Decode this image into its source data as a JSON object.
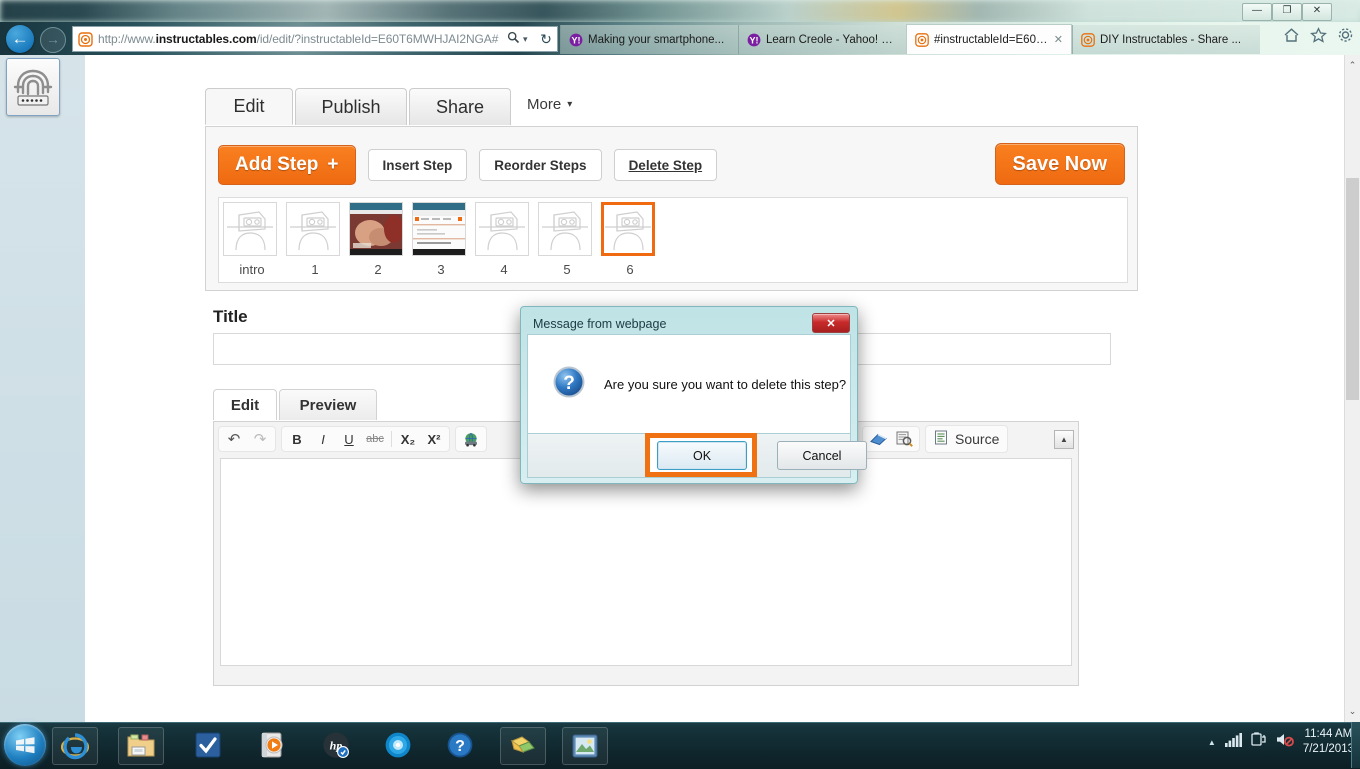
{
  "window": {
    "controls": {
      "minimize": "—",
      "maximize": "❐",
      "close": "✕"
    }
  },
  "browser": {
    "back_icon": "←",
    "forward_icon": "→",
    "address": {
      "prefix": "http://www.",
      "domain": "instructables.com",
      "path": "/id/edit/?instructableId=E60T6MWHJAI2NGA#",
      "full": "http://www.instructables.com/id/edit/?instructableId=E60T6MWHJAI2NGA#",
      "search_icon": "search-icon",
      "caret_icon": "▾",
      "refresh_icon": "↻"
    },
    "tabs": [
      {
        "title": "Making your smartphone...",
        "favicon": "yahoo-icon",
        "active": false,
        "closable": false
      },
      {
        "title": "Learn Creole - Yahoo! Sea...",
        "favicon": "yahoo-icon",
        "active": false,
        "closable": false
      },
      {
        "title": "#instructableId=E60T6...",
        "favicon": "instructables-icon",
        "active": true,
        "closable": true,
        "close_glyph": "✕"
      },
      {
        "title": "DIY Instructables - Share ...",
        "favicon": "instructables-icon",
        "active": false,
        "closable": false
      }
    ],
    "icons": [
      {
        "name": "home-icon",
        "glyph": "⌂"
      },
      {
        "name": "favorites-star-icon",
        "glyph": "☆"
      },
      {
        "name": "tools-gear-icon",
        "glyph": "⚙"
      }
    ]
  },
  "sidebar": {
    "fingerprint_tool": "fingerprint-password-icon"
  },
  "editor": {
    "main_tabs": [
      {
        "label": "Edit",
        "active": true
      },
      {
        "label": "Publish",
        "active": false
      },
      {
        "label": "Share",
        "active": false
      }
    ],
    "more_label": "More",
    "more_caret": "▾",
    "buttons": {
      "add_step": "Add Step",
      "add_step_plus": "+",
      "insert_step": "Insert Step",
      "reorder_steps": "Reorder Steps",
      "delete_step": "Delete Step",
      "save_now": "Save Now"
    },
    "steps": [
      {
        "label": "intro",
        "thumb": "robot-placeholder",
        "selected": false
      },
      {
        "label": "1",
        "thumb": "robot-placeholder",
        "selected": false
      },
      {
        "label": "2",
        "thumb": "photo-hands",
        "selected": false
      },
      {
        "label": "3",
        "thumb": "photo-webpage",
        "selected": false
      },
      {
        "label": "4",
        "thumb": "robot-placeholder",
        "selected": false
      },
      {
        "label": "5",
        "thumb": "robot-placeholder",
        "selected": false
      },
      {
        "label": "6",
        "thumb": "robot-placeholder",
        "selected": true
      }
    ],
    "title_label": "Title",
    "title_value": "",
    "title_placeholder": "",
    "body_tabs": [
      {
        "label": "Edit",
        "active": true
      },
      {
        "label": "Preview",
        "active": false
      }
    ],
    "toolbar": {
      "undo": "↶",
      "redo": "↷",
      "bold": "B",
      "italic": "I",
      "underline": "U",
      "strike": "abc",
      "subscript": "X₂",
      "superscript": "X²",
      "link_globe": "link-globe-icon",
      "paste_word": "paste-from-word-icon",
      "media": "insert-media-icon",
      "eraser": "remove-format-icon",
      "find": "find-replace-icon",
      "source_label": "Source",
      "source_icon": "source-document-icon",
      "collapse": "▲"
    },
    "body_value": ""
  },
  "scrollbar": {
    "up_arrow": "⌃",
    "down_arrow": "⌄"
  },
  "dialog": {
    "title": "Message from webpage",
    "close_glyph": "✕",
    "icon": "question-mark-icon",
    "message": "Are you sure you want to delete this step?",
    "ok_label": "OK",
    "cancel_label": "Cancel",
    "highlight_color": "#f07112"
  },
  "taskbar": {
    "start": "windows-start-orb",
    "items": [
      {
        "name": "internet-explorer-icon"
      },
      {
        "name": "file-explorer-icon"
      },
      {
        "name": "checkmark-app-icon"
      },
      {
        "name": "media-player-icon"
      },
      {
        "name": "hp-support-icon"
      },
      {
        "name": "blue-globe-icon"
      },
      {
        "name": "help-question-icon"
      },
      {
        "name": "folders-icon"
      },
      {
        "name": "photo-viewer-icon"
      }
    ],
    "tray": {
      "expand_glyph": "▲",
      "network_icon": "signal-bars-icon",
      "battery_icon": "battery-plug-icon",
      "volume_icon": "volume-muted-icon",
      "time": "11:44 AM",
      "date": "7/21/2013"
    }
  },
  "colors": {
    "accent_orange": "#ef6a11",
    "dialog_teal": "#bfe3e6",
    "link_blue": "#1b7bbd"
  }
}
